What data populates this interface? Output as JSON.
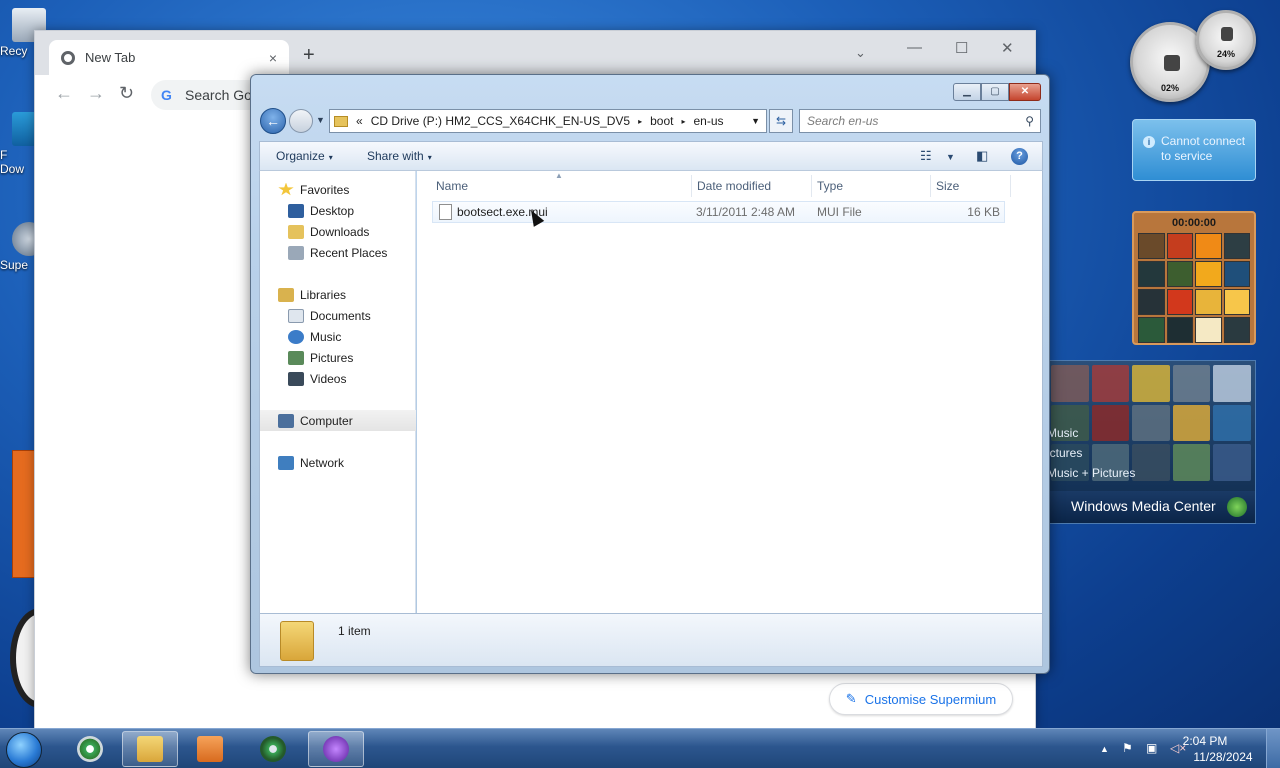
{
  "desktop": {
    "icons": [
      {
        "label": "Recy"
      },
      {
        "label": "F\nDow"
      },
      {
        "label": "Supe"
      }
    ]
  },
  "browser": {
    "tab_title": "New Tab",
    "tab_close": "×",
    "new_tab": "+",
    "tab_search": "⌄",
    "minimize": "—",
    "maximize": "☐",
    "close": "✕",
    "back": "←",
    "forward": "→",
    "reload": "↻",
    "omnibox_placeholder": "Search Goo",
    "google_g": "G",
    "customise_label": "Customise Supermium"
  },
  "gadgets": {
    "cpu_percent": "02%",
    "memory_percent": "24%",
    "weather_text_1": "Cannot connect",
    "weather_text_2": "to service",
    "puzzle_timer": "00:00:00",
    "wmc_items": [
      "Music",
      "ictures",
      "Music + Pictures"
    ],
    "wmc_title": "Windows Media Center"
  },
  "explorer": {
    "address": {
      "crumbs": [
        "CD Drive (P:) HM2_CCS_X64CHK_EN-US_DV5",
        "boot",
        "en-us"
      ],
      "chevrons": "«",
      "separator": "▸"
    },
    "search_placeholder": "Search en-us",
    "toolbar": {
      "organize": "Organize",
      "share_with": "Share with",
      "dropdown": "▾"
    },
    "nav": {
      "favorites": "Favorites",
      "desktop": "Desktop",
      "downloads": "Downloads",
      "recent_places": "Recent Places",
      "libraries": "Libraries",
      "documents": "Documents",
      "music": "Music",
      "pictures": "Pictures",
      "videos": "Videos",
      "computer": "Computer",
      "network": "Network"
    },
    "columns": {
      "name": "Name",
      "date_modified": "Date modified",
      "type": "Type",
      "size": "Size"
    },
    "files": [
      {
        "name": "bootsect.exe.mui",
        "date": "3/11/2011 2:48 AM",
        "type": "MUI File",
        "size": "16 KB"
      }
    ],
    "status": "1 item"
  },
  "taskbar": {
    "time": "2:04 PM",
    "date": "11/28/2024"
  },
  "colors": {
    "accent": "#1a73e8",
    "selection": "#eef5fd"
  }
}
